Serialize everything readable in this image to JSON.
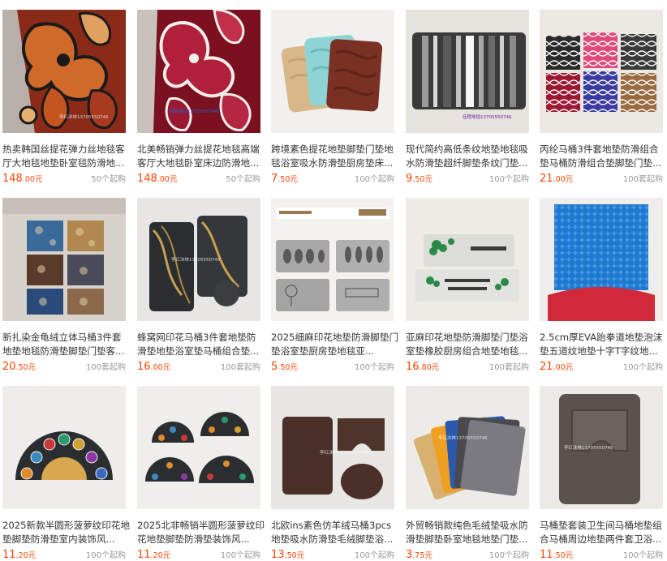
{
  "products": [
    {
      "title": "热卖韩国丝提花弹力丝地毯客厅大地毯地垫卧室毯防滑地...",
      "price_int": "148",
      "price_dec": ".00",
      "unit": "元",
      "moq": "50个起购",
      "art": "rug-brown-floral"
    },
    {
      "title": "北美畅销弹力丝提花地毯高端客厅大地毯卧室床边防滑地...",
      "price_int": "148",
      "price_dec": ".00",
      "unit": "元",
      "moq": "50个起购",
      "art": "rug-red-floral"
    },
    {
      "title": "跨境素色提花地垫脚垫门垫地毯浴室吸水防滑垫厨房垫床...",
      "price_int": "7",
      "price_dec": ".50",
      "unit": "元",
      "moq": "100个起购",
      "art": "mats-three-color"
    },
    {
      "title": "现代简约高低条纹地垫地毯吸水防滑垫超纤脚垫条纹门垫...",
      "price_int": "9",
      "price_dec": ".50",
      "unit": "元",
      "moq": "100个起购",
      "art": "mat-stripes"
    },
    {
      "title": "丙纶马桶3件套地垫防滑组合垫马桶防滑组合垫脚垫门垫...",
      "price_int": "21",
      "price_dec": ".00",
      "unit": "元",
      "moq": "100套起购",
      "art": "sets-trellis"
    },
    {
      "title": "新扎染金龟绒立体马桶3件套地垫地毯防滑垫脚垫门垫客...",
      "price_int": "20",
      "price_dec": ".50",
      "unit": "元",
      "moq": "100套起购",
      "art": "sets-tiedye"
    },
    {
      "title": "蜂窝网印花马桶3件套地垫防滑垫地垫浴室垫马桶组合垫...",
      "price_int": "16",
      "price_dec": ".00",
      "unit": "元",
      "moq": "100套起购",
      "art": "set-kitchen"
    },
    {
      "title": "2025细麻印花地垫防滑脚垫门垫浴室垫厨房垫地毯亚...",
      "price_int": "5",
      "price_dec": ".50",
      "unit": "元",
      "moq": "100个起购",
      "art": "mats-printed"
    },
    {
      "title": "亚麻印花地垫防滑脚垫门垫浴室垫橡胶厨房组合地垫地毯...",
      "price_int": "16",
      "price_dec": ".80",
      "unit": "元",
      "moq": "100套起购",
      "art": "mats-welcome"
    },
    {
      "title": "2.5cm厚EVA跆拳道地垫泡沫垫五道纹地垫十字T字纹地...",
      "price_int": "21",
      "price_dec": ".00",
      "unit": "元",
      "moq": "100个起购",
      "art": "eva-foam"
    },
    {
      "title": "2025新款半圆形菠萝纹印花地垫脚垫防滑垫室内装饰风...",
      "price_int": "11",
      "price_dec": ".20",
      "unit": "元",
      "moq": "100个起购",
      "art": "halfround-one"
    },
    {
      "title": "2025北非畅销半圆形菠萝纹印花地垫脚垫防滑垫装饰风...",
      "price_int": "11",
      "price_dec": ".20",
      "unit": "元",
      "moq": "100个起购",
      "art": "halfround-many"
    },
    {
      "title": "北欧ins素色仿羊绒马桶3pcs地垫吸水防滑垫毛绒脚垫浴...",
      "price_int": "13",
      "price_dec": ".50",
      "unit": "元",
      "moq": "100个起购",
      "art": "set-brown-plush"
    },
    {
      "title": "外贸畅销款纯色毛绒垫吸水防滑垫脚垫卧室地毯地垫门垫...",
      "price_int": "3",
      "price_dec": ".75",
      "unit": "元",
      "moq": "100个起购",
      "art": "mats-fanned"
    },
    {
      "title": "马桶垫套装卫生间马桶地垫组合马桶周边地垫两件套卫浴...",
      "price_int": "11",
      "price_dec": ".50",
      "unit": "元",
      "moq": "100个起购",
      "art": "set-gray-two"
    }
  ],
  "watermarks": {
    "w1": "李红沐林13705550746",
    "w2": "独家授权13705550746",
    "w3": "佳程地毯13705550746",
    "w4": "李红沐林13705550746"
  }
}
